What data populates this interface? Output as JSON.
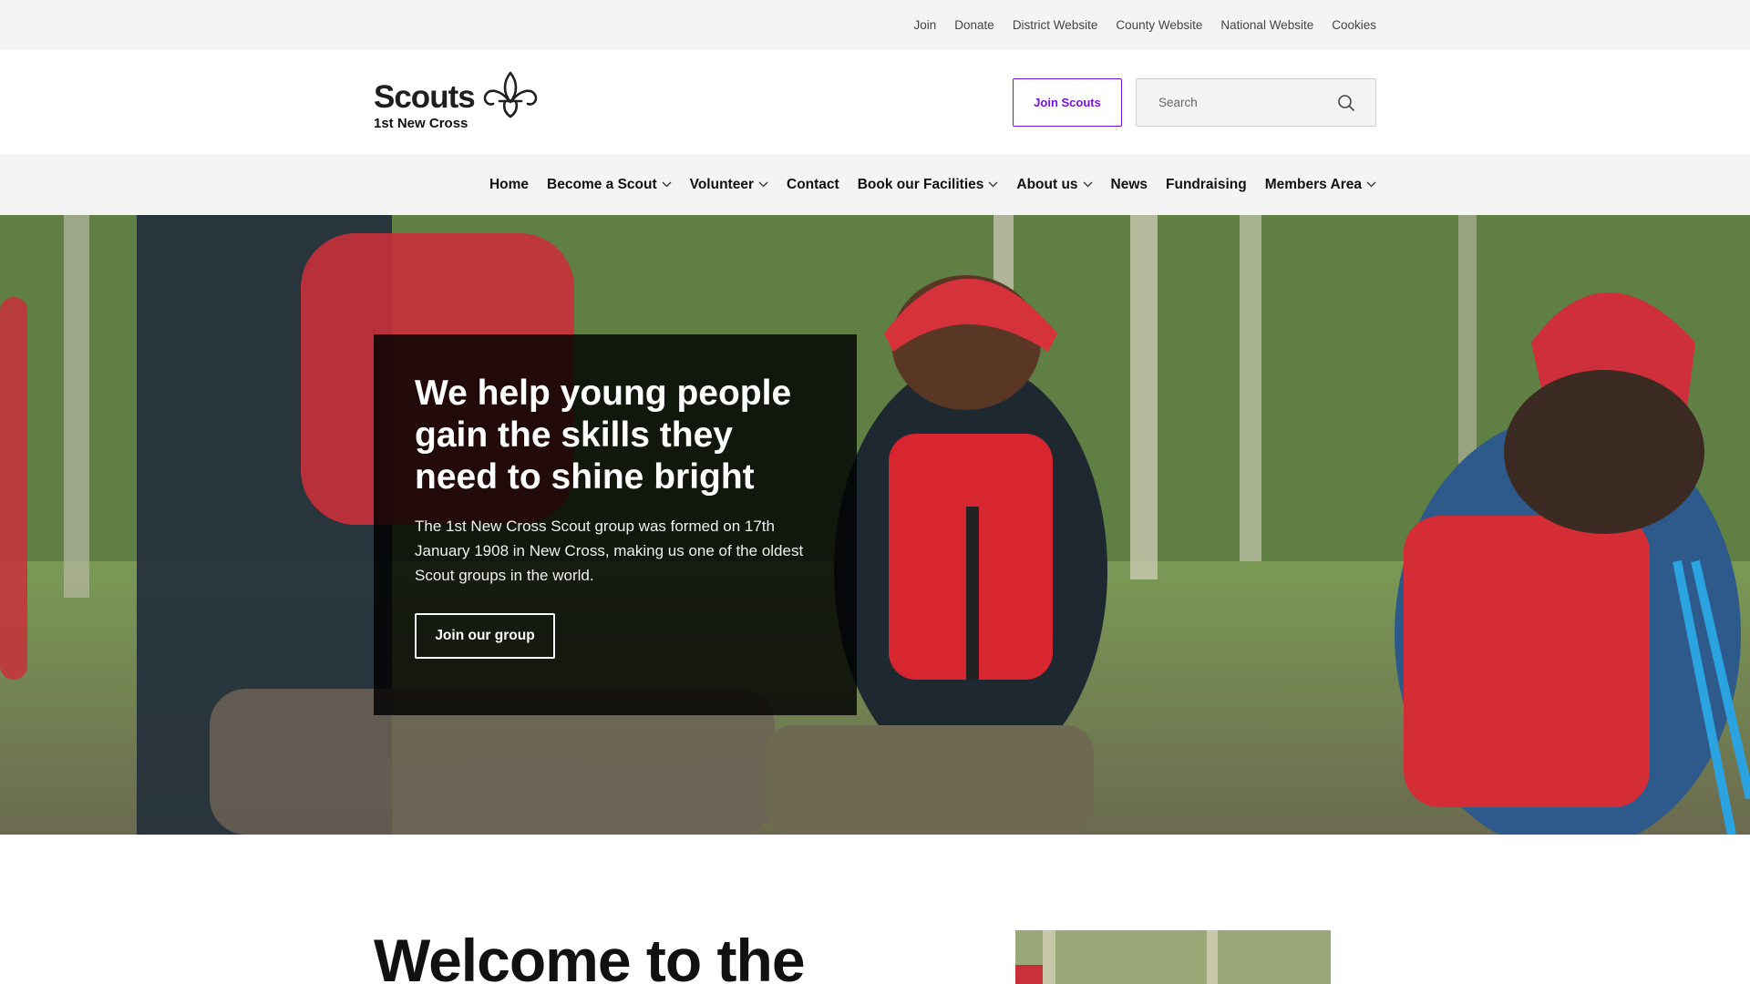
{
  "utility_nav": {
    "links": [
      "Join",
      "Donate",
      "District Website",
      "County Website",
      "National Website",
      "Cookies"
    ]
  },
  "header": {
    "logo_word": "Scouts",
    "logo_sub": "1st New Cross",
    "join_button": "Join Scouts",
    "search_placeholder": "Search",
    "search_icon": "search-icon"
  },
  "nav": {
    "items": [
      {
        "label": "Home",
        "dropdown": false
      },
      {
        "label": "Become a Scout",
        "dropdown": true
      },
      {
        "label": "Volunteer",
        "dropdown": true
      },
      {
        "label": "Contact",
        "dropdown": false
      },
      {
        "label": "Book our Facilities",
        "dropdown": true
      },
      {
        "label": "About us",
        "dropdown": true
      },
      {
        "label": "News",
        "dropdown": false
      },
      {
        "label": "Fundraising",
        "dropdown": false
      },
      {
        "label": "Members Area",
        "dropdown": true
      }
    ]
  },
  "hero": {
    "title": "We help young people gain the skills they need to shine bright",
    "text": "The 1st New Cross Scout group was formed on 17th January 1908 in New Cross, making us one of the oldest Scout groups in the world.",
    "button": "Join our group"
  },
  "welcome": {
    "title": "Welcome to the"
  },
  "colors": {
    "brand_purple": "#7413dc",
    "utility_bg": "#f4f4f4",
    "hero_card_bg": "#000000"
  }
}
